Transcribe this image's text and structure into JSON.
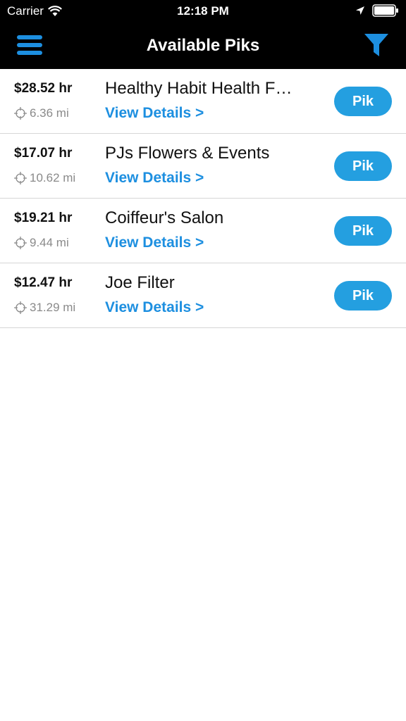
{
  "status_bar": {
    "carrier": "Carrier",
    "time": "12:18 PM"
  },
  "nav": {
    "title": "Available Piks",
    "menu_icon": "hamburger-menu-icon",
    "filter_icon": "filter-funnel-icon",
    "accent": "#1d8fe0"
  },
  "listings": [
    {
      "rate": "$28.52 hr",
      "distance": "6.36 mi",
      "name": "Healthy Habit Health F…",
      "details": "View Details >",
      "action": "Pik"
    },
    {
      "rate": "$17.07 hr",
      "distance": "10.62 mi",
      "name": "PJs Flowers & Events",
      "details": "View Details >",
      "action": "Pik"
    },
    {
      "rate": "$19.21 hr",
      "distance": "9.44 mi",
      "name": "Coiffeur's Salon",
      "details": "View Details >",
      "action": "Pik"
    },
    {
      "rate": "$12.47 hr",
      "distance": "31.29 mi",
      "name": "Joe Filter",
      "details": "View Details >",
      "action": "Pik"
    }
  ]
}
